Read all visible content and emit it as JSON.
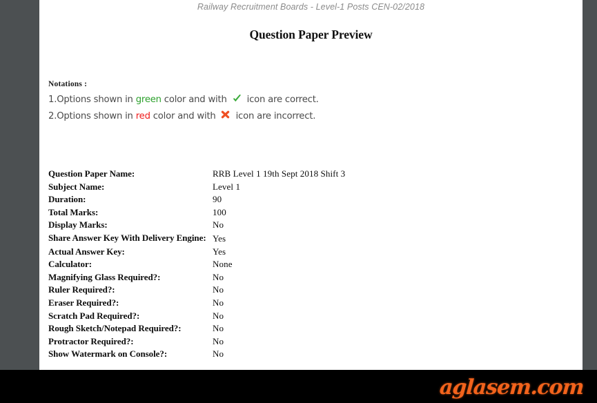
{
  "document": {
    "header": "Railway Recruitment Boards - Level-1 Posts CEN-02/2018",
    "title": "Question Paper Preview"
  },
  "notations": {
    "heading": "Notations :",
    "line1": {
      "number": "1.",
      "text_before_color": "Options shown in ",
      "color_word": "green",
      "text_after_color": " color and with ",
      "icon": "check-mark-icon",
      "icon_color": "#3aab3a",
      "text_after_icon": " icon are correct."
    },
    "line2": {
      "number": "2.",
      "text_before_color": "Options shown in ",
      "color_word": "red",
      "text_after_color": " color and with ",
      "icon": "cross-mark-icon",
      "icon_color": "#ef4f22",
      "text_after_icon": " icon are incorrect."
    }
  },
  "details": {
    "rows": [
      {
        "label": "Question Paper Name:",
        "value": "RRB Level 1 19th Sept 2018 Shift 3",
        "wrap": false
      },
      {
        "label": "Subject Name:",
        "value": "Level 1",
        "wrap": false
      },
      {
        "label": "Duration:",
        "value": "90",
        "wrap": false
      },
      {
        "label": "Total Marks:",
        "value": "100",
        "wrap": false
      },
      {
        "label": "Display Marks:",
        "value": "No",
        "wrap": false
      },
      {
        "label": "Share Answer Key With Delivery Engine:",
        "value": "Yes",
        "wrap": true
      },
      {
        "label": "Actual Answer Key:",
        "value": "Yes",
        "wrap": false
      },
      {
        "label": "Calculator:",
        "value": "None",
        "wrap": false
      },
      {
        "label": "Magnifying Glass Required?:",
        "value": "No",
        "wrap": false
      },
      {
        "label": "Ruler Required?:",
        "value": "No",
        "wrap": false
      },
      {
        "label": "Eraser Required?:",
        "value": "No",
        "wrap": false
      },
      {
        "label": "Scratch Pad Required?:",
        "value": "No",
        "wrap": false
      },
      {
        "label": "Rough Sketch/Notepad Required?:",
        "value": "No",
        "wrap": false
      },
      {
        "label": "Protractor Required?:",
        "value": "No",
        "wrap": false
      },
      {
        "label": "Show Watermark on Console?:",
        "value": "No",
        "wrap": false
      }
    ]
  },
  "watermark": {
    "logo_text": "aglasem.com",
    "logo_color": "#f2631c",
    "bar_color": "#000000"
  },
  "theme": {
    "page_background": "#ffffff",
    "viewer_background": "#4c5052",
    "header_text_color": "#8b8b8b",
    "green": "#2ca02c",
    "red": "#ef1c1c"
  }
}
